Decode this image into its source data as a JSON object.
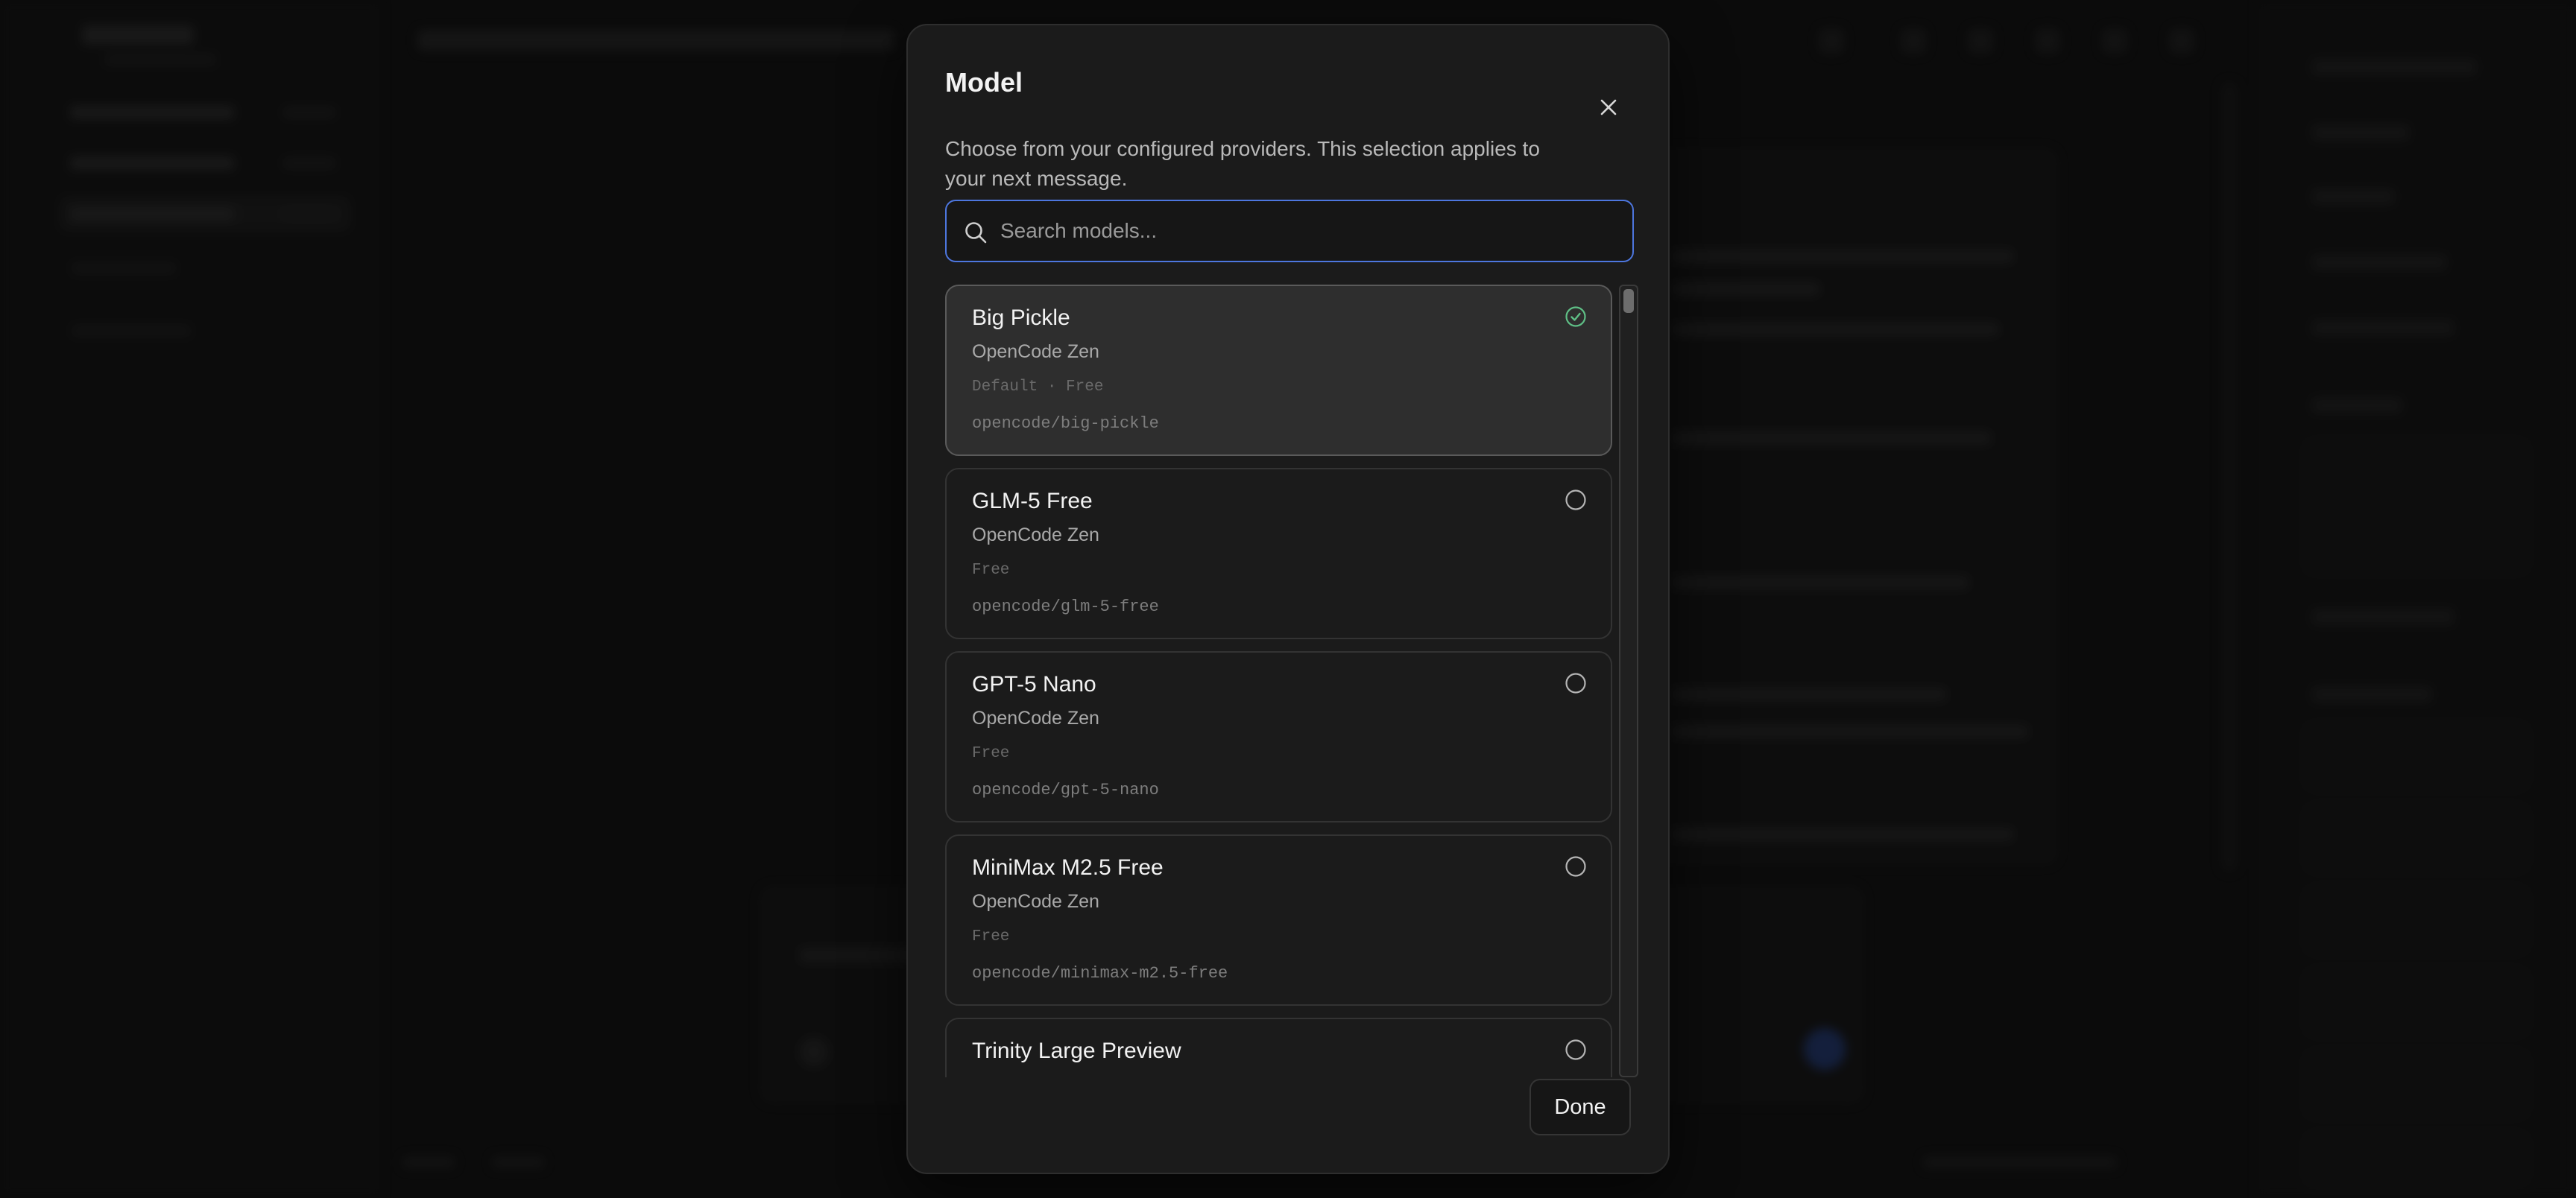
{
  "modal": {
    "title": "Model",
    "description": "Choose from your configured providers. This selection applies to your next message.",
    "close_icon": "close-icon",
    "search": {
      "placeholder": "Search models...",
      "value": "",
      "icon": "search-icon"
    },
    "done_label": "Done",
    "accent_color": "#4d76de",
    "selected_check_color": "#5fbf86",
    "models": [
      {
        "name": "Big Pickle",
        "provider": "OpenCode Zen",
        "tags": "Default · Free",
        "id": "opencode/big-pickle",
        "selected": true
      },
      {
        "name": "GLM-5 Free",
        "provider": "OpenCode Zen",
        "tags": "Free",
        "id": "opencode/glm-5-free",
        "selected": false
      },
      {
        "name": "GPT-5 Nano",
        "provider": "OpenCode Zen",
        "tags": "Free",
        "id": "opencode/gpt-5-nano",
        "selected": false
      },
      {
        "name": "MiniMax M2.5 Free",
        "provider": "OpenCode Zen",
        "tags": "Free",
        "id": "opencode/minimax-m2.5-free",
        "selected": false
      },
      {
        "name": "Trinity Large Preview",
        "provider": "",
        "tags": "",
        "id": "",
        "selected": false
      }
    ]
  }
}
